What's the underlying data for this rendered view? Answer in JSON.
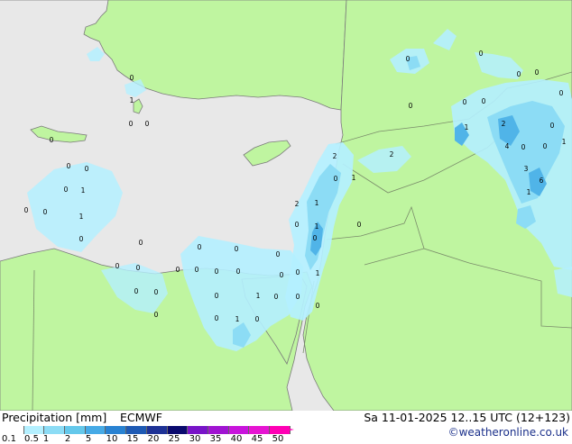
{
  "map": {
    "colors": {
      "sea": "#e8e8e8",
      "land": "#bff5a0",
      "border": "#7a8c6a",
      "coast": "#7a7a7a",
      "precip_light": "#b4f0ff",
      "precip_mid": "#8cdcf5",
      "precip_heavy": "#50b4e8"
    },
    "point_values": [
      {
        "v": "0"
      },
      {
        "v": "0"
      },
      {
        "v": "0"
      },
      {
        "v": "0"
      },
      {
        "v": "0"
      },
      {
        "v": "0"
      },
      {
        "v": "2"
      },
      {
        "v": "1"
      },
      {
        "v": "0"
      },
      {
        "v": "0"
      },
      {
        "v": "0"
      },
      {
        "v": "1"
      },
      {
        "v": "2"
      },
      {
        "v": "0"
      },
      {
        "v": "0"
      },
      {
        "v": "1"
      },
      {
        "v": "2"
      },
      {
        "v": "4"
      },
      {
        "v": "0"
      },
      {
        "v": "1"
      },
      {
        "v": "3"
      },
      {
        "v": "6"
      },
      {
        "v": "0"
      },
      {
        "v": "1"
      },
      {
        "v": "0"
      },
      {
        "v": "0"
      },
      {
        "v": "0"
      },
      {
        "v": "0"
      },
      {
        "v": "1"
      },
      {
        "v": "0"
      },
      {
        "v": "0"
      },
      {
        "v": "0"
      },
      {
        "v": "0"
      },
      {
        "v": "1"
      },
      {
        "v": "0"
      },
      {
        "v": "0"
      },
      {
        "v": "0"
      },
      {
        "v": "0"
      },
      {
        "v": "0"
      },
      {
        "v": "0"
      },
      {
        "v": "0"
      },
      {
        "v": "0"
      },
      {
        "v": "2"
      },
      {
        "v": "1"
      },
      {
        "v": "0"
      },
      {
        "v": "1"
      },
      {
        "v": "0"
      },
      {
        "v": "0"
      },
      {
        "v": "0"
      },
      {
        "v": "0"
      },
      {
        "v": "0"
      },
      {
        "v": "0"
      },
      {
        "v": "0"
      },
      {
        "v": "1"
      },
      {
        "v": "0"
      },
      {
        "v": "0"
      },
      {
        "v": "0"
      },
      {
        "v": "0"
      },
      {
        "v": "1"
      },
      {
        "v": "1"
      },
      {
        "v": "0"
      },
      {
        "v": "0"
      },
      {
        "v": "0"
      },
      {
        "v": "0"
      },
      {
        "v": "0"
      }
    ]
  },
  "legend": {
    "title": "Precipitation [mm]",
    "model": "ECMWF",
    "tick_labels": [
      "0.1",
      "0.5",
      "1",
      "2",
      "5",
      "10",
      "15",
      "20",
      "25",
      "30",
      "35",
      "40",
      "45",
      "50"
    ],
    "colors": [
      "#ffffff",
      "#b4f0ff",
      "#8cdcf5",
      "#64c8eb",
      "#46aae6",
      "#2882d2",
      "#1e5ab4",
      "#1e3296",
      "#0a0a6e",
      "#7814c8",
      "#a014d2",
      "#c814dc",
      "#e614d2",
      "#ff00b4"
    ]
  },
  "run_info": "Sa 11-01-2025 12..15 UTC (12+123)",
  "credit": "©weatheronline.co.uk"
}
